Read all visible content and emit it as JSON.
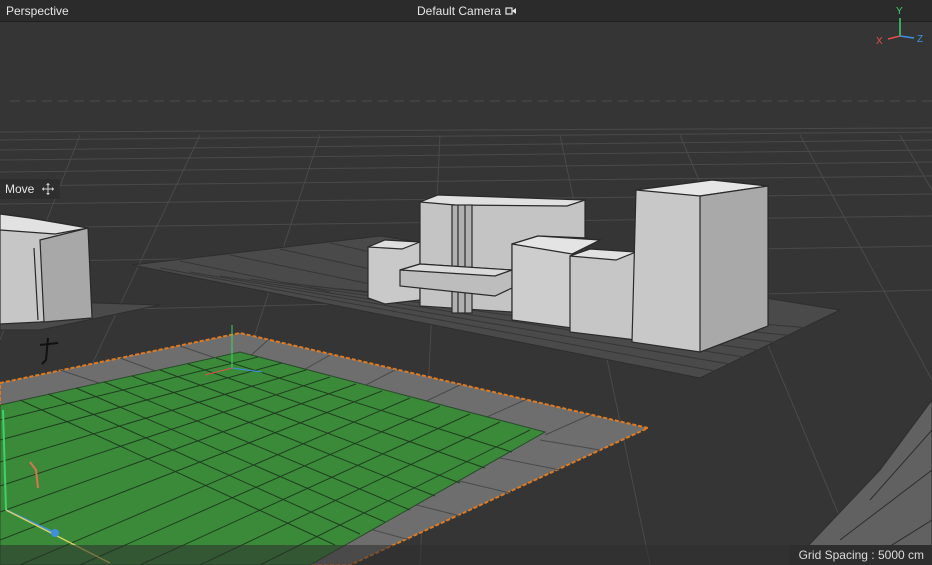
{
  "viewport": {
    "view_name": "Perspective",
    "camera_label": "Default Camera",
    "camera_icon": "camera-icon",
    "active_tool_label": "Move",
    "active_tool_icon": "move-cross-icon",
    "axis_labels": {
      "x": "X",
      "y": "Y",
      "z": "Z"
    },
    "grid_spacing": "Grid Spacing : 5000 cm"
  },
  "colors": {
    "background": "#333333",
    "ground_plane": "#3a8a3a",
    "selection_outline": "#e07a20",
    "axis_x": "#e05050",
    "axis_y": "#3fd16a",
    "axis_z": "#3f8fe0"
  }
}
